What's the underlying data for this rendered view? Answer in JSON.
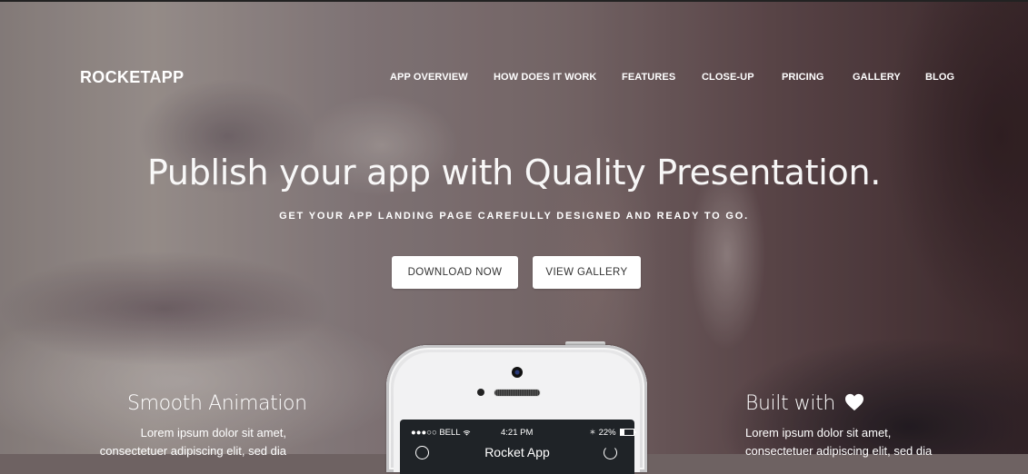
{
  "brand": {
    "name": "ROCKETAPP"
  },
  "nav": {
    "items": [
      {
        "label": "APP OVERVIEW"
      },
      {
        "label": "HOW DOES IT WORK"
      },
      {
        "label": "FEATURES"
      },
      {
        "label": "CLOSE-UP"
      },
      {
        "label": "PRICING"
      },
      {
        "label": "GALLERY"
      },
      {
        "label": "BLOG"
      }
    ]
  },
  "hero": {
    "title": "Publish your app with Quality Presentation.",
    "subtitle": "GET YOUR APP LANDING PAGE CAREFULLY DESIGNED AND READY TO GO.",
    "buttons": {
      "download": "DOWNLOAD NOW",
      "gallery": "VIEW GALLERY"
    }
  },
  "features": {
    "left": {
      "title": "Smooth Animation",
      "text_line1": "Lorem ipsum dolor sit amet,",
      "text_line2": "consectetuer adipiscing elit, sed dia"
    },
    "right": {
      "title": "Built with",
      "title_icon": "heart-icon",
      "text_line1": "Lorem ipsum dolor sit amet,",
      "text_line2": "consectetuer adipiscing elit, sed dia"
    }
  },
  "phone": {
    "carrier": "●●●○○ BELL",
    "wifi_icon": "wifi-icon",
    "time": "4:21 PM",
    "bluetooth_icon": "bluetooth-icon",
    "battery": "22%",
    "app_title": "Rocket App"
  },
  "colors": {
    "text": "#ffffff",
    "button_bg": "#ffffff",
    "button_text": "#333333",
    "screen_bg": "#1f2327"
  }
}
